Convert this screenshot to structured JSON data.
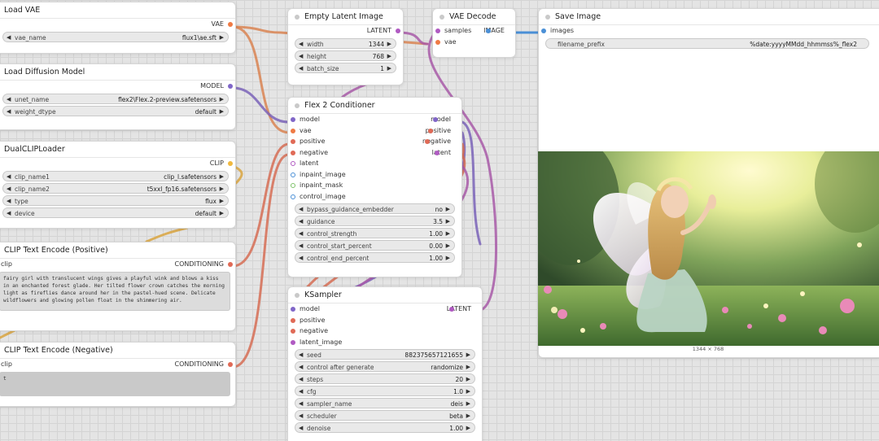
{
  "nodes": {
    "load_vae": {
      "title": "Load VAE",
      "output": "VAE",
      "widgets": [
        {
          "label": "vae_name",
          "value": "flux1\\ae.sft"
        }
      ]
    },
    "load_diffusion": {
      "title": "Load Diffusion Model",
      "output": "MODEL",
      "widgets": [
        {
          "label": "unet_name",
          "value": "flex2\\Flex.2-preview.safetensors"
        },
        {
          "label": "weight_dtype",
          "value": "default"
        }
      ]
    },
    "dual_clip": {
      "title": "DualCLIPLoader",
      "output": "CLIP",
      "widgets": [
        {
          "label": "clip_name1",
          "value": "clip_l.safetensors"
        },
        {
          "label": "clip_name2",
          "value": "t5xxl_fp16.safetensors"
        },
        {
          "label": "type",
          "value": "flux"
        },
        {
          "label": "device",
          "value": "default"
        }
      ]
    },
    "clip_pos": {
      "title": "CLIP Text Encode (Positive)",
      "input": "clip",
      "output": "CONDITIONING",
      "text": "fairy girl with translucent wings gives a playful wink and blows a kiss in an enchanted forest glade. Her tilted flower crown catches the morning light as fireflies dance around her in the pastel-hued scene. Delicate wildflowers and glowing pollen float in the shimmering air."
    },
    "clip_neg": {
      "title": "CLIP Text Encode (Negative)",
      "input": "clip",
      "output": "CONDITIONING",
      "text": "t"
    },
    "empty_latent": {
      "title": "Empty Latent Image",
      "output": "LATENT",
      "widgets": [
        {
          "label": "width",
          "value": "1344"
        },
        {
          "label": "height",
          "value": "768"
        },
        {
          "label": "batch_size",
          "value": "1"
        }
      ]
    },
    "vae_decode": {
      "title": "VAE Decode",
      "inputs": [
        "samples",
        "vae"
      ],
      "output": "IMAGE"
    },
    "flex2": {
      "title": "Flex 2 Conditioner",
      "inputs": [
        "model",
        "vae",
        "positive",
        "negative",
        "latent",
        "inpaint_image",
        "inpaint_mask",
        "control_image"
      ],
      "outputs": [
        "model",
        "positive",
        "negative",
        "latent"
      ],
      "widgets": [
        {
          "label": "bypass_guidance_embedder",
          "value": "no"
        },
        {
          "label": "guidance",
          "value": "3.5"
        },
        {
          "label": "control_strength",
          "value": "1.00"
        },
        {
          "label": "control_start_percent",
          "value": "0.00"
        },
        {
          "label": "control_end_percent",
          "value": "1.00"
        }
      ]
    },
    "ksampler": {
      "title": "KSampler",
      "inputs": [
        "model",
        "positive",
        "negative",
        "latent_image"
      ],
      "output": "LATENT",
      "widgets": [
        {
          "label": "seed",
          "value": "882375657121655"
        },
        {
          "label": "control after generate",
          "value": "randomize"
        },
        {
          "label": "steps",
          "value": "20"
        },
        {
          "label": "cfg",
          "value": "1.0"
        },
        {
          "label": "sampler_name",
          "value": "deis"
        },
        {
          "label": "scheduler",
          "value": "beta"
        },
        {
          "label": "denoise",
          "value": "1.00"
        }
      ]
    },
    "save_image": {
      "title": "Save Image",
      "input": "images",
      "widgets": [
        {
          "label": "filename_prefix",
          "value": "%date:yyyyMMdd_hhmmss%_flex2"
        }
      ],
      "image_caption": "1344 × 768"
    }
  },
  "colors": {
    "model": "#8066c8",
    "vae": "#ef7a44",
    "conditioning": "#e06a56",
    "latent": "#b05ac2",
    "image": "#4a8fd6",
    "clip": "#f0b83e"
  }
}
